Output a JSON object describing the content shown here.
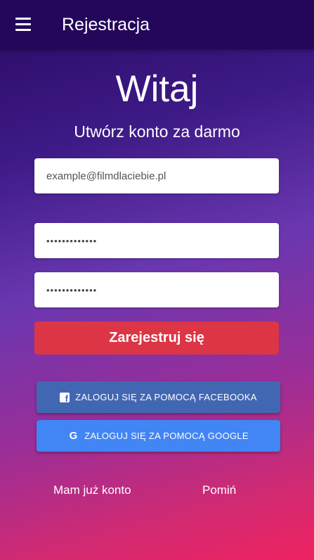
{
  "appbar": {
    "title": "Rejestracja",
    "menu_icon": "hamburger-menu-icon"
  },
  "main": {
    "heading": "Witaj",
    "subheading": "Utwórz konto za darmo"
  },
  "form": {
    "email_placeholder": "example@filmdlaciebie.pl",
    "password_value": "•••••••••••••",
    "password_confirm_value": "•••••••••••••",
    "register_label": "Zarejestruj się"
  },
  "social": {
    "facebook_label": "ZALOGUJ SIĘ ZA POMOCĄ FACEBOOKA",
    "facebook_icon": "facebook-icon",
    "google_label": "ZALOGUJ SIĘ ZA POMOCĄ GOOGLE",
    "google_icon": "google-icon",
    "google_glyph": "G"
  },
  "footer": {
    "have_account_label": "Mam już konto",
    "skip_label": "Pomiń"
  },
  "colors": {
    "appbar": "#24075a",
    "register": "#dc3545",
    "facebook": "#4267b2",
    "google": "#4285f4"
  }
}
